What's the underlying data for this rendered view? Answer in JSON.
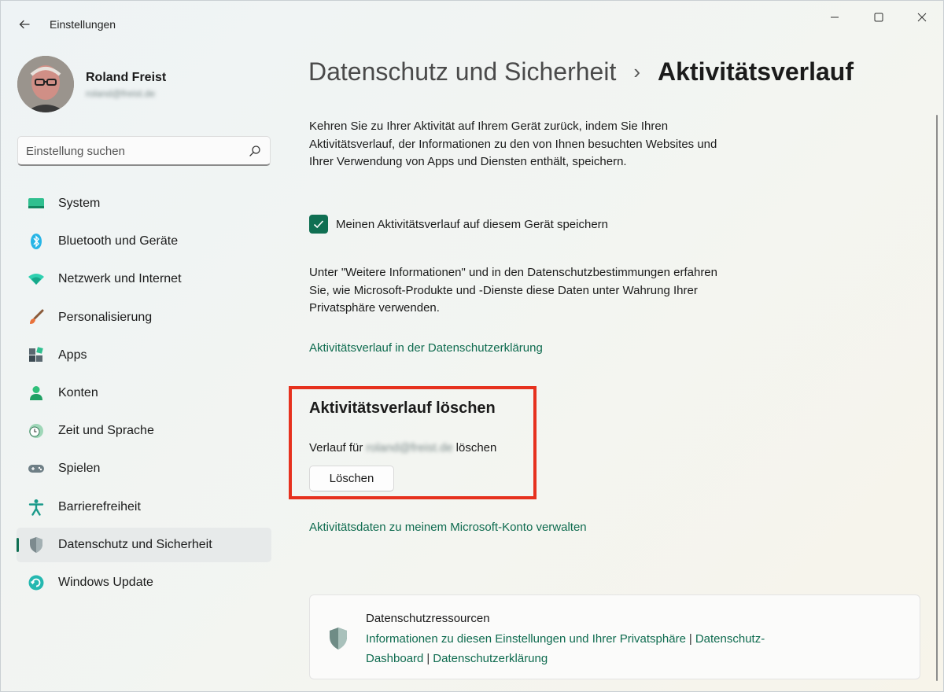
{
  "window": {
    "title": "Einstellungen"
  },
  "user": {
    "name": "Roland Freist",
    "email": "roland@freist.de"
  },
  "search": {
    "placeholder": "Einstellung suchen"
  },
  "sidebar": {
    "items": [
      {
        "label": "System",
        "icon": "monitor-icon"
      },
      {
        "label": "Bluetooth und Geräte",
        "icon": "bluetooth-icon"
      },
      {
        "label": "Netzwerk und Internet",
        "icon": "wifi-icon"
      },
      {
        "label": "Personalisierung",
        "icon": "paintbrush-icon"
      },
      {
        "label": "Apps",
        "icon": "apps-icon"
      },
      {
        "label": "Konten",
        "icon": "person-icon"
      },
      {
        "label": "Zeit und Sprache",
        "icon": "clock-globe-icon"
      },
      {
        "label": "Spielen",
        "icon": "gamepad-icon"
      },
      {
        "label": "Barrierefreiheit",
        "icon": "accessibility-icon"
      },
      {
        "label": "Datenschutz und Sicherheit",
        "icon": "shield-icon",
        "active": true
      },
      {
        "label": "Windows Update",
        "icon": "update-icon"
      }
    ]
  },
  "main": {
    "breadcrumb": {
      "parent": "Datenschutz und Sicherheit",
      "separator": "›",
      "current": "Aktivitätsverlauf"
    },
    "intro": "Kehren Sie zu Ihrer Aktivität auf Ihrem Gerät zurück, indem Sie Ihren Aktivitätsverlauf, der Informationen zu den von Ihnen besuchten Websites und Ihrer Verwendung von Apps und Diensten enthält, speichern.",
    "checkbox": {
      "label": "Meinen Aktivitätsverlauf auf diesem Gerät speichern",
      "checked": true
    },
    "info": "Unter \"Weitere Informationen\" und in den Datenschutzbestimmungen erfahren Sie, wie Microsoft-Produkte und -Dienste diese Daten unter Wahrung Ihrer Privatsphäre verwenden.",
    "privacy_link": "Aktivitätsverlauf in der Datenschutzerklärung",
    "clear_section": {
      "title": "Aktivitätsverlauf löschen",
      "text_prefix": "Verlauf für",
      "text_email": "roland@freist.de",
      "text_suffix": "löschen",
      "button": "Löschen"
    },
    "account_link": "Aktivitätsdaten zu meinem Microsoft-Konto verwalten",
    "resources": {
      "title": "Datenschutzressourcen",
      "links": [
        "Informationen zu diesen Einstellungen und Ihrer Privatsphäre",
        "Datenschutz-Dashboard",
        "Datenschutzerklärung"
      ],
      "separator": "|"
    }
  },
  "colors": {
    "accent": "#0f6f52",
    "link": "#0e6b4f",
    "highlight": "#e6311e"
  }
}
